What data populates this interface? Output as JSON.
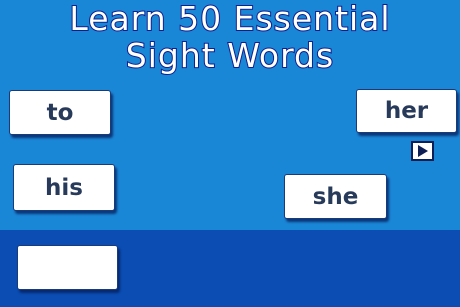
{
  "title": {
    "line1": "Learn 50 Essential",
    "line2": "Sight Words"
  },
  "cards": {
    "to": "to",
    "his": "his",
    "she": "she",
    "her": "her"
  },
  "drop_slot": {
    "text": ""
  },
  "colors": {
    "background": "#1a86d6",
    "bottom_panel": "#0b4db3",
    "title_outline": "#121e8c",
    "card_text": "#283a5a"
  },
  "icons": {
    "play": "play-icon"
  }
}
